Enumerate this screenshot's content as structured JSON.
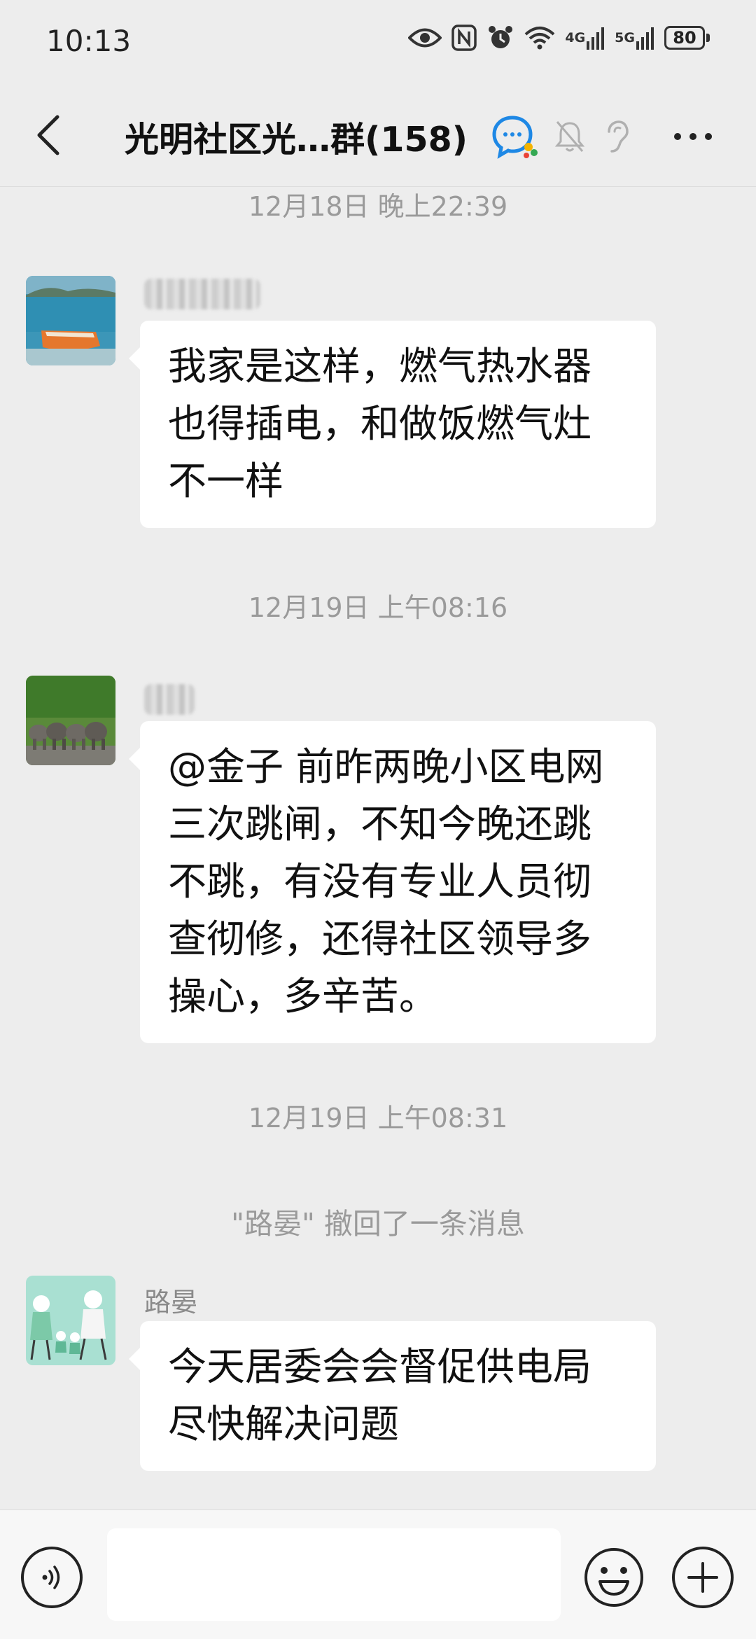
{
  "status_bar": {
    "time": "10:13",
    "signal_4g_label": "4G",
    "signal_5g_label": "5G",
    "battery": "80"
  },
  "header": {
    "title": "光明社区光…群(158)"
  },
  "chat": {
    "separators": [
      "12月18日 晚上22:39",
      "12月19日 上午08:16",
      "12月19日 上午08:31"
    ],
    "messages": [
      {
        "text": "我家是这样，燃气热水器也得插电，和做饭燃气灶不一样"
      },
      {
        "text": "@金子  前昨两晚小区电网三次跳闸，不知今晚还跳不跳，有没有专业人员彻查彻修，还得社区领导多操心，多辛苦。"
      },
      {
        "sender": "路晏",
        "text": "今天居委会会督促供电局尽快解决问题"
      }
    ],
    "system_message": "\"路晏\" 撤回了一条消息"
  },
  "input": {
    "placeholder": ""
  },
  "colors": {
    "background": "#ededed",
    "bubble": "#ffffff",
    "timestamp": "#9a9a9a",
    "accent": "#1aad19"
  }
}
